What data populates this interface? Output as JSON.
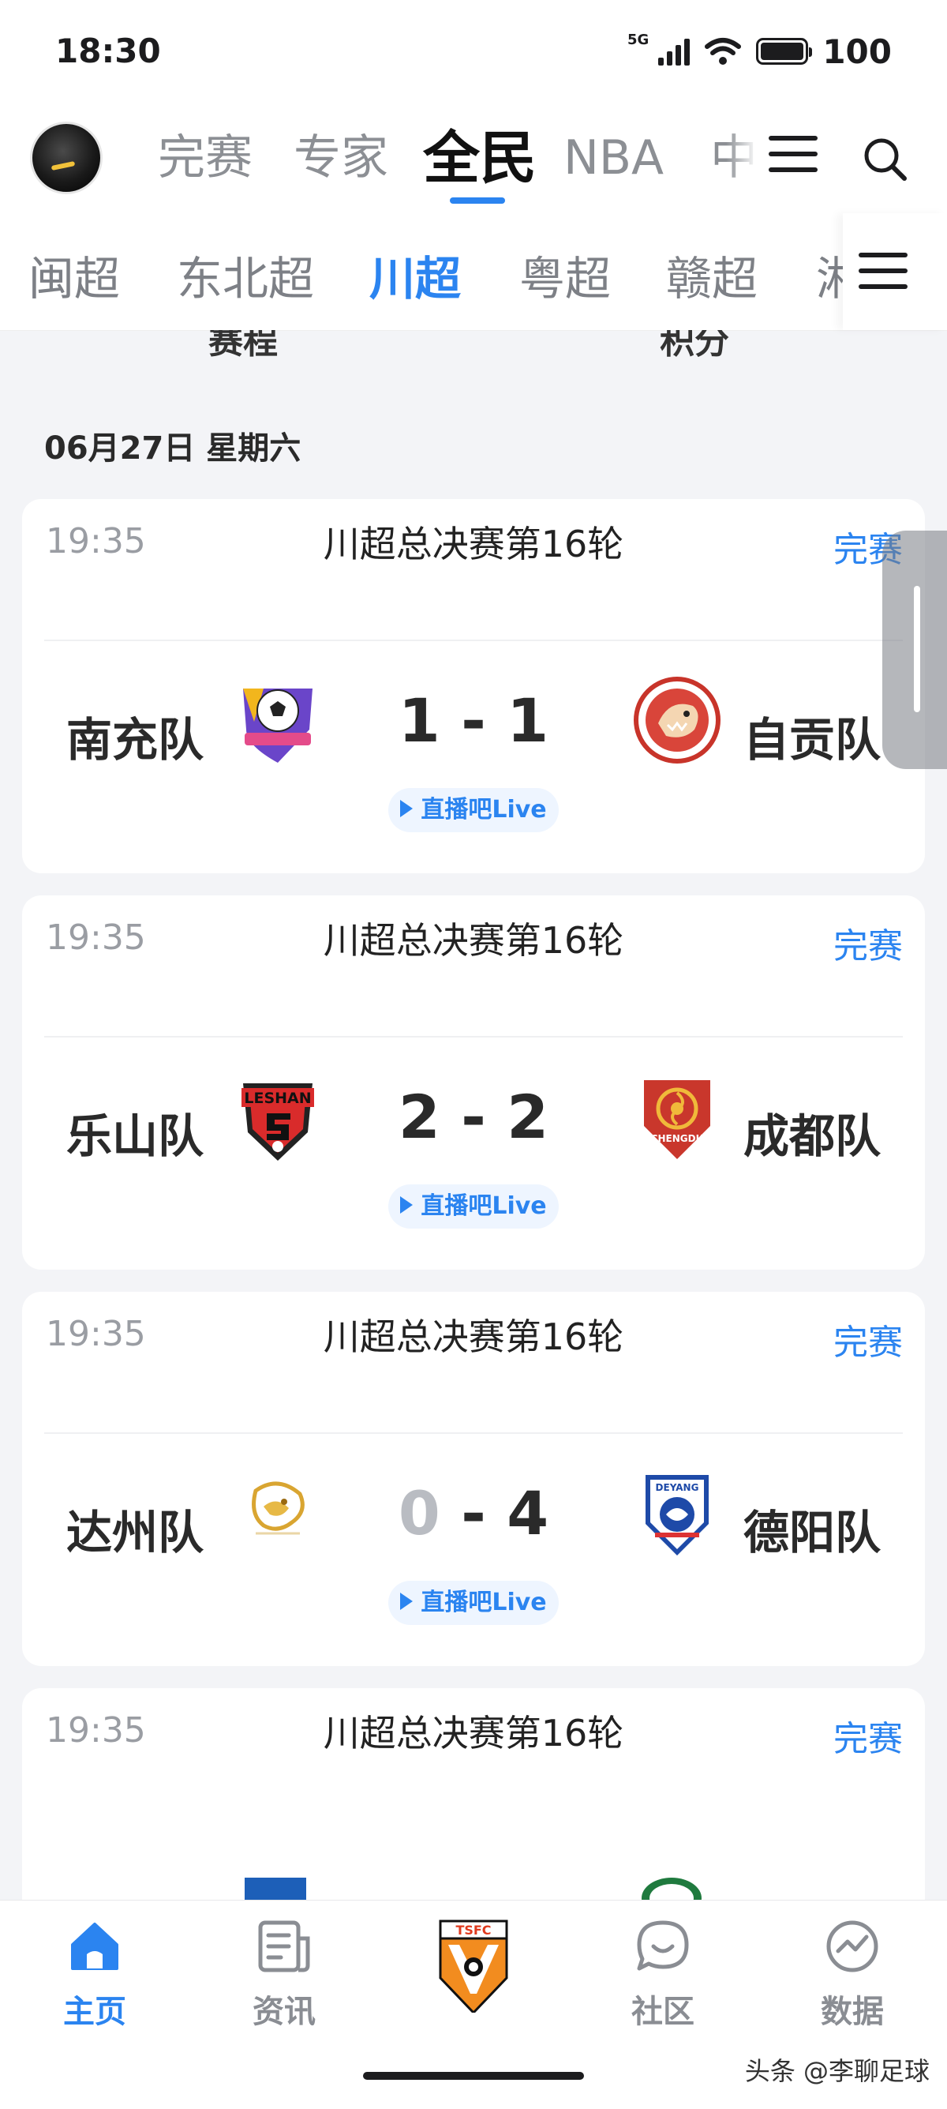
{
  "status_bar": {
    "time": "18:30",
    "network": "5G",
    "battery": "100"
  },
  "top_nav": {
    "tabs": [
      "完赛",
      "专家",
      "全民",
      "NBA",
      "中"
    ],
    "active_tab": "全民"
  },
  "sub_nav": {
    "tabs": [
      "闽超",
      "东北超",
      "川超",
      "粤超",
      "赣超",
      "湘"
    ],
    "active_tab": "川超"
  },
  "section_tabs": [
    "赛程",
    "积分"
  ],
  "date_header": "06月27日 星期六",
  "matches": [
    {
      "time": "19:35",
      "round": "川超总决赛第16轮",
      "status": "完赛",
      "home": {
        "name": "南充队"
      },
      "away": {
        "name": "自贡队"
      },
      "home_score": "1",
      "away_score": "1",
      "live": "直播吧Live"
    },
    {
      "time": "19:35",
      "round": "川超总决赛第16轮",
      "status": "完赛",
      "home": {
        "name": "乐山队",
        "logo_text": "LESHAN"
      },
      "away": {
        "name": "成都队",
        "logo_text": "CHENGDU"
      },
      "home_score": "2",
      "away_score": "2",
      "live": "直播吧Live"
    },
    {
      "time": "19:35",
      "round": "川超总决赛第16轮",
      "status": "完赛",
      "home": {
        "name": "达州队"
      },
      "away": {
        "name": "德阳队",
        "logo_text": "DEYANG"
      },
      "home_score": "0",
      "away_score": "4",
      "live": "直播吧Live"
    },
    {
      "time": "19:35",
      "round": "川超总决赛第16轮",
      "status": "完赛"
    }
  ],
  "bottom_nav": {
    "items": [
      {
        "label": "主页",
        "icon": "home-icon",
        "active": true
      },
      {
        "label": "资讯",
        "icon": "news-icon",
        "active": false
      },
      {
        "label": "",
        "icon": "tsfc-logo",
        "logo_text": "TSFC",
        "active": false
      },
      {
        "label": "社区",
        "icon": "chat-bubble-icon",
        "active": false
      },
      {
        "label": "数据",
        "icon": "data-chart-icon",
        "active": false
      }
    ]
  },
  "watermark": "头条 @李聊足球",
  "colors": {
    "accent": "#2b84f0",
    "background": "#f3f4f7",
    "card": "#ffffff"
  }
}
